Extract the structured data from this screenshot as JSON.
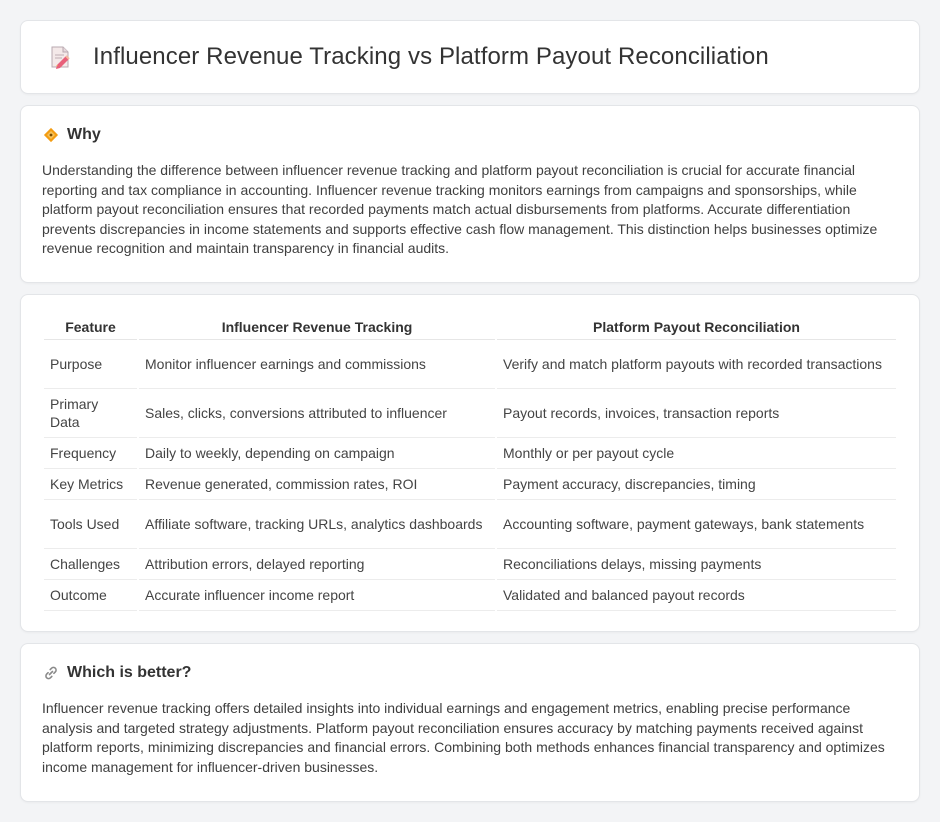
{
  "title": "Influencer Revenue Tracking vs Platform Payout Reconciliation",
  "why": {
    "heading": "Why",
    "text": "Understanding the difference between influencer revenue tracking and platform payout reconciliation is crucial for accurate financial reporting and tax compliance in accounting. Influencer revenue tracking monitors earnings from campaigns and sponsorships, while platform payout reconciliation ensures that recorded payments match actual disbursements from platforms. Accurate differentiation prevents discrepancies in income statements and supports effective cash flow management. This distinction helps businesses optimize revenue recognition and maintain transparency in financial audits."
  },
  "table": {
    "headers": [
      "Feature",
      "Influencer Revenue Tracking",
      "Platform Payout Reconciliation"
    ],
    "rows": [
      [
        "Purpose",
        "Monitor influencer earnings and commissions",
        "Verify and match platform payouts with recorded transactions"
      ],
      [
        "Primary Data",
        "Sales, clicks, conversions attributed to influencer",
        "Payout records, invoices, transaction reports"
      ],
      [
        "Frequency",
        "Daily to weekly, depending on campaign",
        "Monthly or per payout cycle"
      ],
      [
        "Key Metrics",
        "Revenue generated, commission rates, ROI",
        "Payment accuracy, discrepancies, timing"
      ],
      [
        "Tools Used",
        "Affiliate software, tracking URLs, analytics dashboards",
        "Accounting software, payment gateways, bank statements"
      ],
      [
        "Challenges",
        "Attribution errors, delayed reporting",
        "Reconciliations delays, missing payments"
      ],
      [
        "Outcome",
        "Accurate influencer income report",
        "Validated and balanced payout records"
      ]
    ]
  },
  "better": {
    "heading": "Which is better?",
    "text": "Influencer revenue tracking offers detailed insights into individual earnings and engagement metrics, enabling precise performance analysis and targeted strategy adjustments. Platform payout reconciliation ensures accuracy by matching payments received against platform reports, minimizing discrepancies and financial errors. Combining both methods enhances financial transparency and optimizes income management for influencer-driven businesses."
  },
  "icons": {
    "title": "document-edit-icon",
    "why": "diamond-sign-icon",
    "better": "link-icon"
  },
  "colors": {
    "background": "#f3f4f6",
    "card": "#ffffff",
    "accent_orange": "#f39c12",
    "accent_pink": "#e8607a"
  }
}
